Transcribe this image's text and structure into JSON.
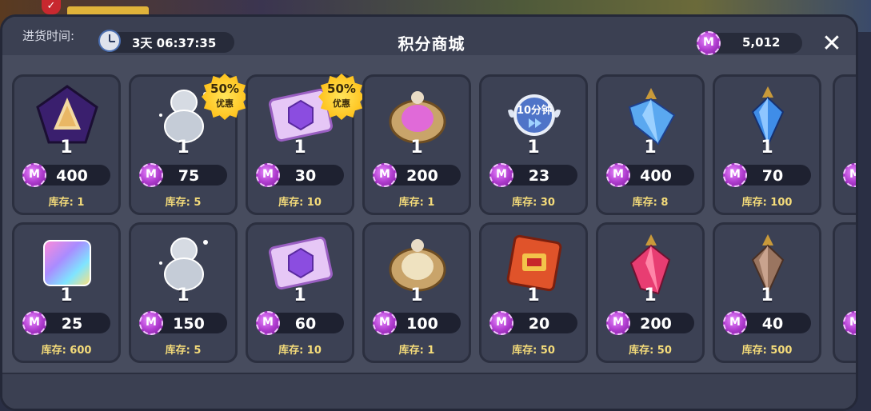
{
  "header": {
    "restock_label": "进货时间:",
    "timer": "3天 06:37:35",
    "title": "积分商城",
    "currency_amount": "5,012",
    "currency_icon": "m-coin-icon",
    "close_icon": "close-icon"
  },
  "coin_letter": "M",
  "background_check": "✓",
  "items": [
    {
      "icon": "pentagon-crest-icon",
      "qty": "1",
      "price": "400",
      "stock": "库存: 1",
      "badge": null
    },
    {
      "icon": "silhouette-cookie-icon",
      "qty": "1",
      "price": "75",
      "stock": "库存: 5",
      "badge": {
        "pct": "50%",
        "sub": "优惠"
      }
    },
    {
      "icon": "gem-ticket-icon",
      "qty": "1",
      "price": "30",
      "stock": "库存: 10",
      "badge": {
        "pct": "50%",
        "sub": "优惠"
      }
    },
    {
      "icon": "pink-pouch-icon",
      "qty": "1",
      "price": "200",
      "stock": "库存: 1",
      "badge": null
    },
    {
      "icon": "speedup-10min-icon",
      "qty": "1",
      "price": "23",
      "stock": "库存: 30",
      "badge": null,
      "label": "10分钟"
    },
    {
      "icon": "blue-crystal-icon",
      "qty": "1",
      "price": "400",
      "stock": "库存: 8",
      "badge": null
    },
    {
      "icon": "blue-shard-icon",
      "qty": "1",
      "price": "70",
      "stock": "库存: 100",
      "badge": null
    },
    {
      "icon": "rainbow-cube-icon",
      "qty": "1",
      "price": "25",
      "stock": "库存: 600",
      "badge": null
    },
    {
      "icon": "silhouette-cookie-icon",
      "qty": "1",
      "price": "150",
      "stock": "库存: 5",
      "badge": null
    },
    {
      "icon": "gem-ticket-icon",
      "qty": "1",
      "price": "60",
      "stock": "库存: 10",
      "badge": null
    },
    {
      "icon": "cream-pouch-icon",
      "qty": "1",
      "price": "100",
      "stock": "库存: 1",
      "badge": null
    },
    {
      "icon": "red-envelope-icon",
      "qty": "1",
      "price": "20",
      "stock": "库存: 50",
      "badge": null
    },
    {
      "icon": "red-crystal-icon",
      "qty": "1",
      "price": "200",
      "stock": "库存: 50",
      "badge": null
    },
    {
      "icon": "bronze-crystal-icon",
      "qty": "1",
      "price": "40",
      "stock": "库存: 500",
      "badge": null
    }
  ],
  "colors": {
    "stock_text": "#f5dc7a",
    "panel": "#474c5e",
    "card": "#3c4154",
    "coin": "#b03ccf"
  }
}
